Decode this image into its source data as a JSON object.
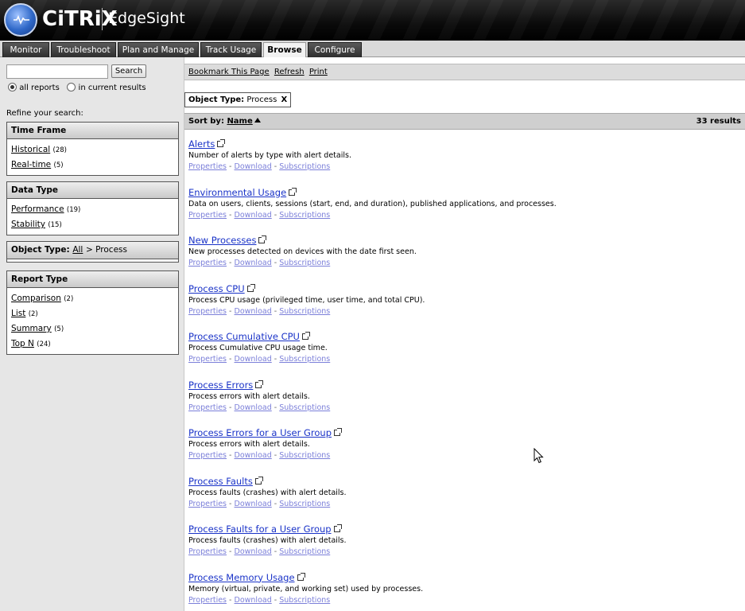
{
  "header": {
    "brand": "CiTRiX",
    "product": "EdgeSight"
  },
  "nav": {
    "tabs": [
      {
        "label": "Monitor"
      },
      {
        "label": "Troubleshoot"
      },
      {
        "label": "Plan and Manage"
      },
      {
        "label": "Track Usage"
      },
      {
        "label": "Browse",
        "active": true
      },
      {
        "label": "Configure"
      }
    ]
  },
  "search": {
    "value": "",
    "button": "Search",
    "scope_all": "all reports",
    "scope_current": "in current results",
    "refine_label": "Refine your search:"
  },
  "facets": {
    "time_frame": {
      "title": "Time Frame",
      "items": [
        {
          "label": "Historical",
          "count": "(28)"
        },
        {
          "label": "Real-time",
          "count": "(5)"
        }
      ]
    },
    "data_type": {
      "title": "Data Type",
      "items": [
        {
          "label": "Performance",
          "count": "(19)"
        },
        {
          "label": "Stability",
          "count": "(15)"
        }
      ]
    },
    "object_type": {
      "label": "Object Type:",
      "all": "All",
      "current": "> Process"
    },
    "report_type": {
      "title": "Report Type",
      "items": [
        {
          "label": "Comparison",
          "count": "(2)"
        },
        {
          "label": "List",
          "count": "(2)"
        },
        {
          "label": "Summary",
          "count": "(5)"
        },
        {
          "label": "Top N",
          "count": "(24)"
        }
      ]
    }
  },
  "toolbar": {
    "bookmark": "Bookmark This Page",
    "refresh": "Refresh",
    "print": "Print"
  },
  "filter_tag": {
    "label": "Object Type:",
    "value": "Process",
    "remove": "X"
  },
  "sortbar": {
    "label": "Sort by:",
    "field": "Name",
    "results": "33 results"
  },
  "link_labels": {
    "properties": "Properties",
    "download": "Download",
    "subscriptions": "Subscriptions",
    "sep": "-"
  },
  "reports": [
    {
      "title": "Alerts",
      "desc": "Number of alerts by type with alert details."
    },
    {
      "title": "Environmental Usage",
      "desc": "Data on users, clients, sessions (start, end, and duration), published applications, and processes."
    },
    {
      "title": "New Processes",
      "desc": "New processes detected on devices with the date first seen."
    },
    {
      "title": "Process CPU",
      "desc": "Process CPU usage (privileged time, user time, and total CPU)."
    },
    {
      "title": "Process Cumulative CPU",
      "desc": "Process Cumulative CPU usage time."
    },
    {
      "title": "Process Errors",
      "desc": "Process errors with alert details."
    },
    {
      "title": "Process Errors for a User Group",
      "desc": "Process errors with alert details."
    },
    {
      "title": "Process Faults",
      "desc": "Process faults (crashes) with alert details."
    },
    {
      "title": "Process Faults for a User Group",
      "desc": "Process faults (crashes) with alert details."
    },
    {
      "title": "Process Memory Usage",
      "desc": "Memory (virtual, private, and working set) used by processes."
    }
  ]
}
